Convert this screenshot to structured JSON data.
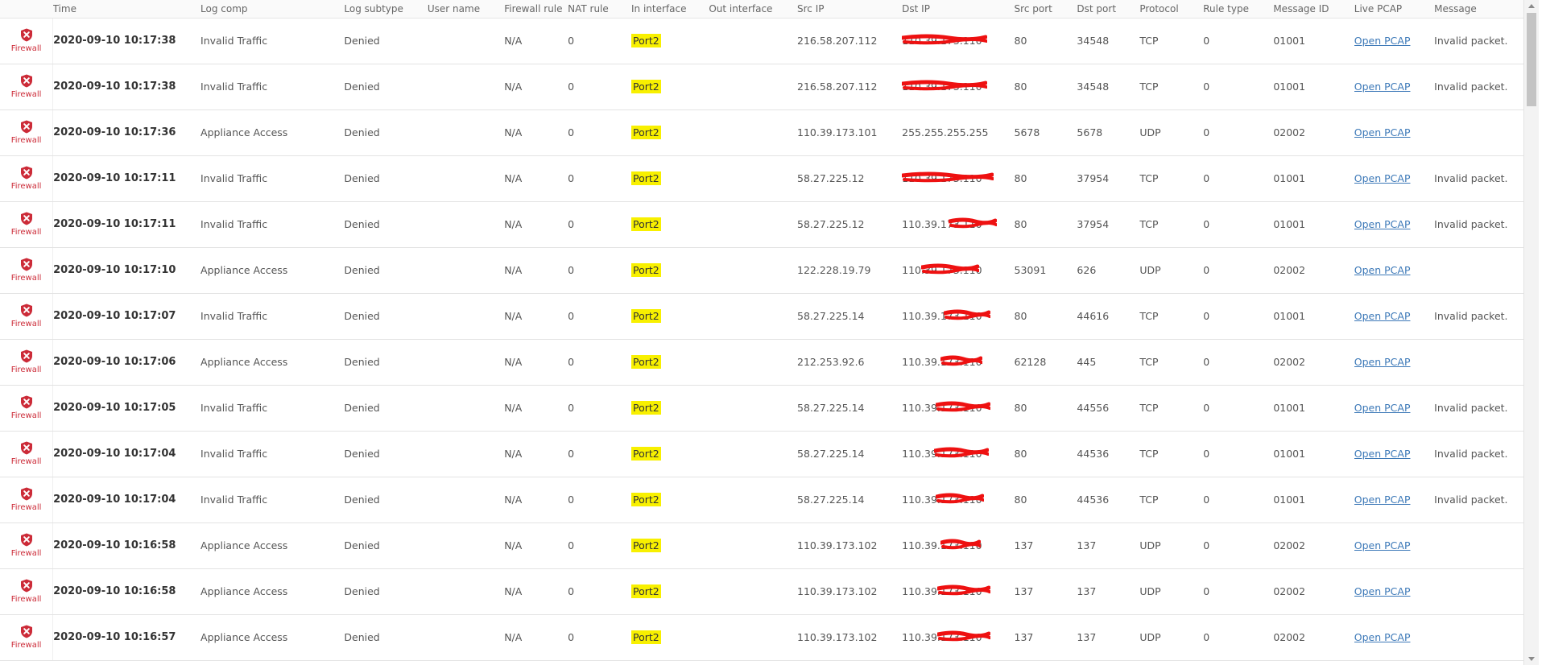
{
  "columns": [
    "Time",
    "Log comp",
    "Log subtype",
    "User name",
    "Firewall rule",
    "NAT rule",
    "In interface",
    "Out interface",
    "Src IP",
    "Dst IP",
    "Src port",
    "Dst port",
    "Protocol",
    "Rule type",
    "Message ID",
    "Live PCAP",
    "Message"
  ],
  "icon_label": "Firewall",
  "colors": {
    "firewall_red": "#cc2b38",
    "port_highlight": "#f8f000",
    "link_blue": "#3d79b8",
    "redaction_red": "#ee1111"
  },
  "rows": [
    {
      "time": "2020-09-10 10:17:38",
      "log_comp": "Invalid Traffic",
      "log_subtype": "Denied",
      "user_name": "",
      "firewall_rule": "N/A",
      "nat_rule": "0",
      "in_interface": "Port2",
      "out_interface": "",
      "src_ip": "216.58.207.112",
      "dst_ip": "110.39.173.110",
      "src_port": "80",
      "dst_port": "34548",
      "protocol": "TCP",
      "rule_type": "0",
      "message_id": "01001",
      "live_pcap": "Open PCAP",
      "message": "Invalid packet."
    },
    {
      "time": "2020-09-10 10:17:38",
      "log_comp": "Invalid Traffic",
      "log_subtype": "Denied",
      "user_name": "",
      "firewall_rule": "N/A",
      "nat_rule": "0",
      "in_interface": "Port2",
      "out_interface": "",
      "src_ip": "216.58.207.112",
      "dst_ip": "110.39.173.110",
      "src_port": "80",
      "dst_port": "34548",
      "protocol": "TCP",
      "rule_type": "0",
      "message_id": "01001",
      "live_pcap": "Open PCAP",
      "message": "Invalid packet."
    },
    {
      "time": "2020-09-10 10:17:36",
      "log_comp": "Appliance Access",
      "log_subtype": "Denied",
      "user_name": "",
      "firewall_rule": "N/A",
      "nat_rule": "0",
      "in_interface": "Port2",
      "out_interface": "",
      "src_ip": "110.39.173.101",
      "dst_ip": "255.255.255.255",
      "src_port": "5678",
      "dst_port": "5678",
      "protocol": "UDP",
      "rule_type": "0",
      "message_id": "02002",
      "live_pcap": "Open PCAP",
      "message": ""
    },
    {
      "time": "2020-09-10 10:17:11",
      "log_comp": "Invalid Traffic",
      "log_subtype": "Denied",
      "user_name": "",
      "firewall_rule": "N/A",
      "nat_rule": "0",
      "in_interface": "Port2",
      "out_interface": "",
      "src_ip": "58.27.225.12",
      "dst_ip": "110.39.173.110",
      "src_port": "80",
      "dst_port": "37954",
      "protocol": "TCP",
      "rule_type": "0",
      "message_id": "01001",
      "live_pcap": "Open PCAP",
      "message": "Invalid packet."
    },
    {
      "time": "2020-09-10 10:17:11",
      "log_comp": "Invalid Traffic",
      "log_subtype": "Denied",
      "user_name": "",
      "firewall_rule": "N/A",
      "nat_rule": "0",
      "in_interface": "Port2",
      "out_interface": "",
      "src_ip": "58.27.225.12",
      "dst_ip": "110.39.173.110",
      "src_port": "80",
      "dst_port": "37954",
      "protocol": "TCP",
      "rule_type": "0",
      "message_id": "01001",
      "live_pcap": "Open PCAP",
      "message": "Invalid packet."
    },
    {
      "time": "2020-09-10 10:17:10",
      "log_comp": "Appliance Access",
      "log_subtype": "Denied",
      "user_name": "",
      "firewall_rule": "N/A",
      "nat_rule": "0",
      "in_interface": "Port2",
      "out_interface": "",
      "src_ip": "122.228.19.79",
      "dst_ip": "110.39.173.110",
      "src_port": "53091",
      "dst_port": "626",
      "protocol": "UDP",
      "rule_type": "0",
      "message_id": "02002",
      "live_pcap": "Open PCAP",
      "message": ""
    },
    {
      "time": "2020-09-10 10:17:07",
      "log_comp": "Invalid Traffic",
      "log_subtype": "Denied",
      "user_name": "",
      "firewall_rule": "N/A",
      "nat_rule": "0",
      "in_interface": "Port2",
      "out_interface": "",
      "src_ip": "58.27.225.14",
      "dst_ip": "110.39.173.110",
      "src_port": "80",
      "dst_port": "44616",
      "protocol": "TCP",
      "rule_type": "0",
      "message_id": "01001",
      "live_pcap": "Open PCAP",
      "message": "Invalid packet."
    },
    {
      "time": "2020-09-10 10:17:06",
      "log_comp": "Appliance Access",
      "log_subtype": "Denied",
      "user_name": "",
      "firewall_rule": "N/A",
      "nat_rule": "0",
      "in_interface": "Port2",
      "out_interface": "",
      "src_ip": "212.253.92.6",
      "dst_ip": "110.39.173.110",
      "src_port": "62128",
      "dst_port": "445",
      "protocol": "TCP",
      "rule_type": "0",
      "message_id": "02002",
      "live_pcap": "Open PCAP",
      "message": ""
    },
    {
      "time": "2020-09-10 10:17:05",
      "log_comp": "Invalid Traffic",
      "log_subtype": "Denied",
      "user_name": "",
      "firewall_rule": "N/A",
      "nat_rule": "0",
      "in_interface": "Port2",
      "out_interface": "",
      "src_ip": "58.27.225.14",
      "dst_ip": "110.39.173.110",
      "src_port": "80",
      "dst_port": "44556",
      "protocol": "TCP",
      "rule_type": "0",
      "message_id": "01001",
      "live_pcap": "Open PCAP",
      "message": "Invalid packet."
    },
    {
      "time": "2020-09-10 10:17:04",
      "log_comp": "Invalid Traffic",
      "log_subtype": "Denied",
      "user_name": "",
      "firewall_rule": "N/A",
      "nat_rule": "0",
      "in_interface": "Port2",
      "out_interface": "",
      "src_ip": "58.27.225.14",
      "dst_ip": "110.39.173.110",
      "src_port": "80",
      "dst_port": "44536",
      "protocol": "TCP",
      "rule_type": "0",
      "message_id": "01001",
      "live_pcap": "Open PCAP",
      "message": "Invalid packet."
    },
    {
      "time": "2020-09-10 10:17:04",
      "log_comp": "Invalid Traffic",
      "log_subtype": "Denied",
      "user_name": "",
      "firewall_rule": "N/A",
      "nat_rule": "0",
      "in_interface": "Port2",
      "out_interface": "",
      "src_ip": "58.27.225.14",
      "dst_ip": "110.39.173.110",
      "src_port": "80",
      "dst_port": "44536",
      "protocol": "TCP",
      "rule_type": "0",
      "message_id": "01001",
      "live_pcap": "Open PCAP",
      "message": "Invalid packet."
    },
    {
      "time": "2020-09-10 10:16:58",
      "log_comp": "Appliance Access",
      "log_subtype": "Denied",
      "user_name": "",
      "firewall_rule": "N/A",
      "nat_rule": "0",
      "in_interface": "Port2",
      "out_interface": "",
      "src_ip": "110.39.173.102",
      "dst_ip": "110.39.173.110",
      "src_port": "137",
      "dst_port": "137",
      "protocol": "UDP",
      "rule_type": "0",
      "message_id": "02002",
      "live_pcap": "Open PCAP",
      "message": ""
    },
    {
      "time": "2020-09-10 10:16:58",
      "log_comp": "Appliance Access",
      "log_subtype": "Denied",
      "user_name": "",
      "firewall_rule": "N/A",
      "nat_rule": "0",
      "in_interface": "Port2",
      "out_interface": "",
      "src_ip": "110.39.173.102",
      "dst_ip": "110.39.173.110",
      "src_port": "137",
      "dst_port": "137",
      "protocol": "UDP",
      "rule_type": "0",
      "message_id": "02002",
      "live_pcap": "Open PCAP",
      "message": ""
    },
    {
      "time": "2020-09-10 10:16:57",
      "log_comp": "Appliance Access",
      "log_subtype": "Denied",
      "user_name": "",
      "firewall_rule": "N/A",
      "nat_rule": "0",
      "in_interface": "Port2",
      "out_interface": "",
      "src_ip": "110.39.173.102",
      "dst_ip": "110.39.173.110",
      "src_port": "137",
      "dst_port": "137",
      "protocol": "UDP",
      "rule_type": "0",
      "message_id": "02002",
      "live_pcap": "Open PCAP",
      "message": ""
    }
  ]
}
